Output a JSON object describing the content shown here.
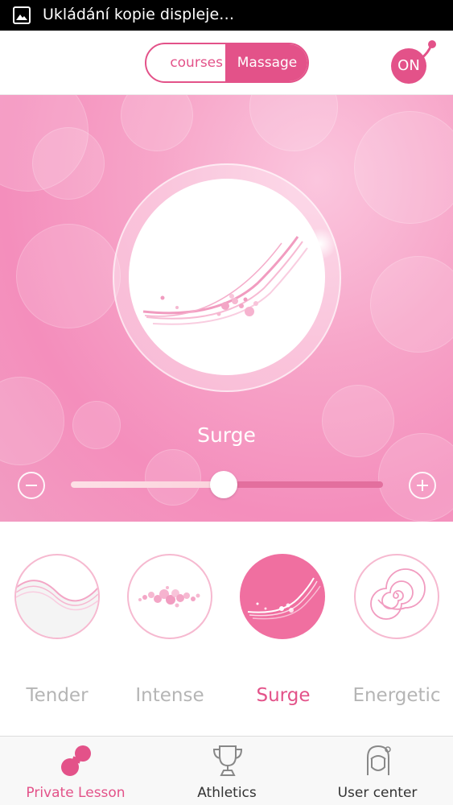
{
  "status_bar": {
    "text": "Ukládání kopie displeje…",
    "icon": "image-icon"
  },
  "header": {
    "segments": [
      {
        "label": "courses",
        "selected": false
      },
      {
        "label": "Massage",
        "selected": true
      }
    ],
    "power_button": {
      "label": "ON",
      "icon": "power-on-icon"
    },
    "accent_color": "#e35289"
  },
  "hero": {
    "current_mode": "Surge",
    "intensity_fraction": 0.49,
    "minus_icon": "minus-icon",
    "plus_icon": "plus-icon"
  },
  "modes": [
    {
      "label": "Tender",
      "icon": "wave-icon",
      "active": false
    },
    {
      "label": "Intense",
      "icon": "bubbles-icon",
      "active": false
    },
    {
      "label": "Surge",
      "icon": "surge-icon",
      "active": true
    },
    {
      "label": "Energetic",
      "icon": "spiral-icon",
      "active": false
    }
  ],
  "tabs": [
    {
      "label": "Private Lesson",
      "icon": "peanut-icon",
      "active": true
    },
    {
      "label": "Athletics",
      "icon": "trophy-icon",
      "active": false
    },
    {
      "label": "User center",
      "icon": "user-icon",
      "active": false
    }
  ]
}
